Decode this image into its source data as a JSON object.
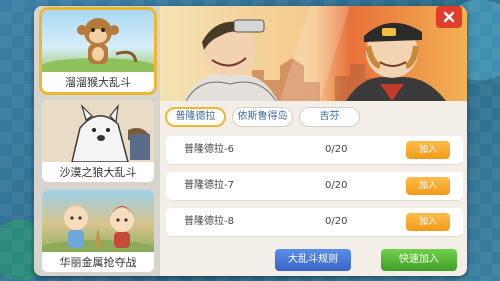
{
  "modes": [
    {
      "label": "溜溜猴大乱斗",
      "selected": true
    },
    {
      "label": "沙漠之狼大乱斗",
      "selected": false
    },
    {
      "label": "华丽金属抢夺战",
      "selected": false
    }
  ],
  "tabs": [
    {
      "label": "普隆德拉",
      "active": true
    },
    {
      "label": "依斯鲁得岛",
      "active": false
    },
    {
      "label": "吉芬",
      "active": false
    }
  ],
  "rooms": [
    {
      "name": "普隆德拉-6",
      "count": "0/20",
      "action": "加入"
    },
    {
      "name": "普隆德拉-7",
      "count": "0/20",
      "action": "加入"
    },
    {
      "name": "普隆德拉-8",
      "count": "0/20",
      "action": "加入"
    }
  ],
  "buttons": {
    "rules": "大乱斗规则",
    "quick_join": "快速加入"
  },
  "colors": {
    "accent": "#f0b630",
    "close": "#e23d2b",
    "rules_button": "#4a78d6",
    "join_button": "#5ab53a",
    "row_button": "#f4a626"
  },
  "icons": {
    "close": "close-icon"
  }
}
